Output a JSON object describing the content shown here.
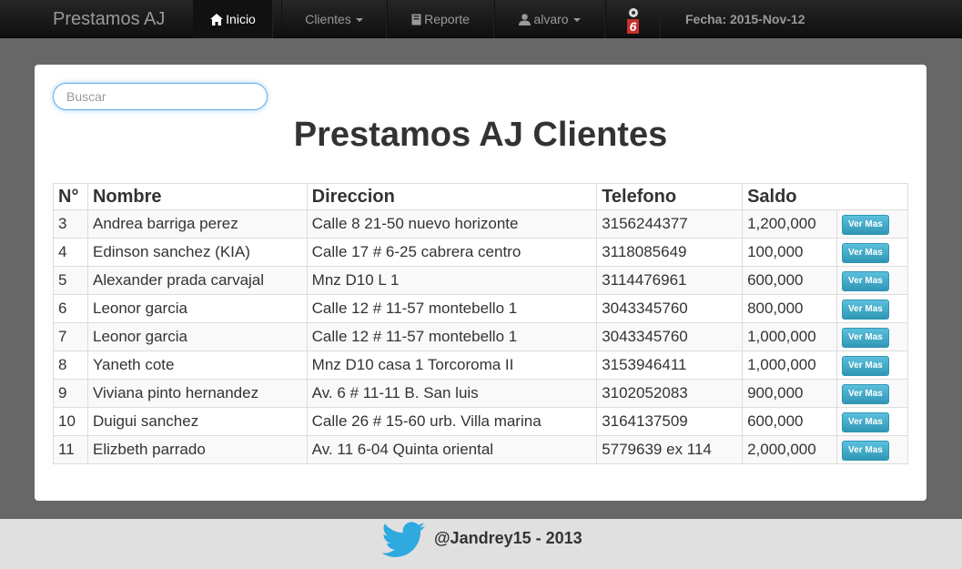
{
  "nav": {
    "brand": "Prestamos AJ",
    "inicio": "Inicio",
    "clientes": "Clientes",
    "reporte": "Reporte",
    "user": "alvaro",
    "notif_count": "6",
    "fecha": "Fecha: 2015-Nov-12"
  },
  "search": {
    "placeholder": "Buscar",
    "value": ""
  },
  "page_title": "Prestamos AJ Clientes",
  "table": {
    "headers": [
      "N°",
      "Nombre",
      "Direccion",
      "Telefono",
      "Saldo"
    ],
    "button_label": "Ver Mas",
    "rows": [
      {
        "n": "3",
        "nombre": "Andrea barriga perez",
        "direccion": "Calle 8 21-50 nuevo horizonte",
        "telefono": "3156244377",
        "saldo": "1,200,000"
      },
      {
        "n": "4",
        "nombre": "Edinson sanchez (KIA)",
        "direccion": "Calle 17 # 6-25 cabrera centro",
        "telefono": "3118085649",
        "saldo": "100,000"
      },
      {
        "n": "5",
        "nombre": "Alexander prada carvajal",
        "direccion": "Mnz D10 L 1",
        "telefono": "3114476961",
        "saldo": "600,000"
      },
      {
        "n": "6",
        "nombre": "Leonor garcia",
        "direccion": "Calle 12 # 11-57 montebello 1",
        "telefono": "3043345760",
        "saldo": "800,000"
      },
      {
        "n": "7",
        "nombre": "Leonor garcia",
        "direccion": "Calle 12 # 11-57 montebello 1",
        "telefono": "3043345760",
        "saldo": "1,000,000"
      },
      {
        "n": "8",
        "nombre": "Yaneth cote",
        "direccion": "Mnz D10 casa 1 Torcoroma II",
        "telefono": "3153946411",
        "saldo": "1,000,000"
      },
      {
        "n": "9",
        "nombre": "Viviana pinto hernandez",
        "direccion": "Av. 6 # 11-11 B. San luis",
        "telefono": "3102052083",
        "saldo": "900,000"
      },
      {
        "n": "10",
        "nombre": "Duigui sanchez",
        "direccion": "Calle 26 # 15-60 urb. Villa marina",
        "telefono": "3164137509",
        "saldo": "600,000"
      },
      {
        "n": "11",
        "nombre": "Elizbeth parrado",
        "direccion": "Av. 11 6-04 Quinta oriental",
        "telefono": "5779639 ex 114",
        "saldo": "2,000,000"
      }
    ]
  },
  "footer": {
    "text": "@Jandrey15 - 2013",
    "icon": "twitter-bird-icon"
  },
  "colors": {
    "navbar": "#1b1b1b",
    "background": "#676767",
    "button": "#49afcd",
    "badge": "#c9302c"
  }
}
